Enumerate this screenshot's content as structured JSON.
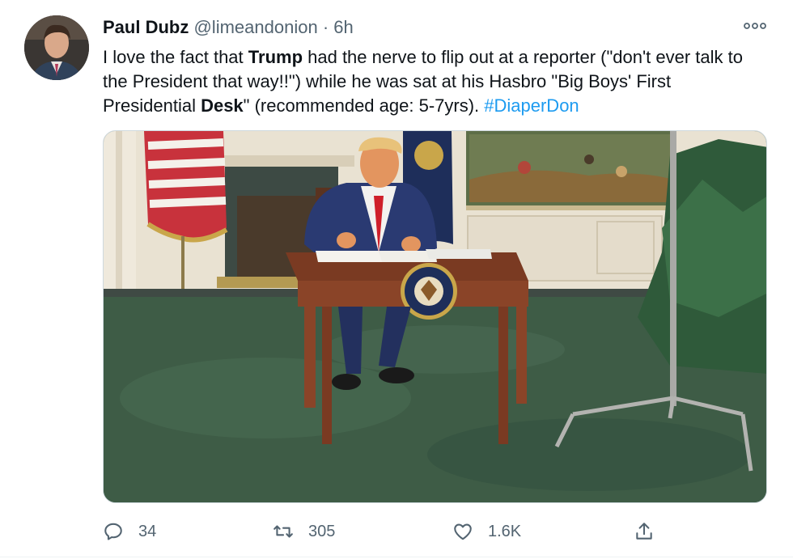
{
  "tweet": {
    "author": {
      "name": "Paul Dubz",
      "handle": "@limeandonion",
      "separator": "·",
      "time": "6h"
    },
    "text": {
      "part1": "I love the fact that ",
      "bold1": "Trump",
      "part2": " had the nerve to flip out at a reporter (\"don't ever talk to the President that way!!\") while he was sat at his Hasbro \"Big Boys' First Presidential ",
      "bold2": "Desk",
      "part3": "\" (recommended age: 5-7yrs). ",
      "hashtag": "#DiaperDon"
    },
    "media": {
      "seal_text": "SEAL OF THE PRESIDENT OF THE UNITED STATES"
    },
    "actions": {
      "replies": "34",
      "retweets": "305",
      "likes": "1.6K"
    }
  },
  "colors": {
    "text": "#0f1419",
    "secondary": "#536471",
    "link": "#1d9bf0"
  },
  "icons": [
    "more-icon",
    "reply-icon",
    "retweet-icon",
    "like-icon",
    "share-icon"
  ]
}
